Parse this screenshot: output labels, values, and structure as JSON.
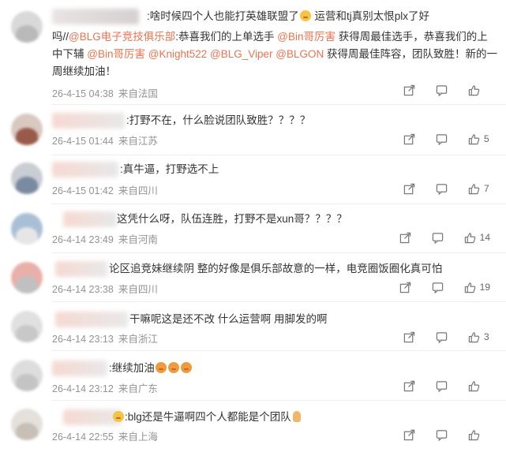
{
  "comments": [
    {
      "lines": [
        [
          {
            "t": ":啥时候四个人也能打英雄联盟了"
          },
          {
            "emoji": "crown-emoji"
          },
          {
            "t": " 运营和tj真别太恨plx了好"
          }
        ],
        [
          {
            "t": "吗//"
          },
          {
            "t": "@BLG电子竞技俱乐部",
            "link": true
          },
          {
            "t": ":恭喜我们的上单选手 "
          },
          {
            "t": "@Bin哥厉害",
            "link": true
          },
          {
            "t": " 获得周最佳选手，恭喜我们的上"
          }
        ],
        [
          {
            "t": "中下辅 "
          },
          {
            "t": "@Bin哥厉害",
            "link": true
          },
          {
            "t": " "
          },
          {
            "t": "@Knight522",
            "link": true
          },
          {
            "t": " "
          },
          {
            "t": "@BLG_Viper",
            "link": true
          },
          {
            "t": " "
          },
          {
            "t": "@BLGON",
            "link": true
          },
          {
            "t": " 获得周最佳阵容，团队致胜！新的一"
          }
        ],
        [
          {
            "t": "周继续加油！"
          }
        ]
      ],
      "date": "26-4-15 04:38",
      "location": "来自法国",
      "likes": ""
    },
    {
      "lines": [
        [
          {
            "t": ":打野不在，什么脸说团队致胜？？？？"
          }
        ]
      ],
      "date": "26-4-15 01:44",
      "location": "来自江苏",
      "likes": "5"
    },
    {
      "lines": [
        [
          {
            "t": ":真牛逼，打野选不上"
          }
        ]
      ],
      "date": "26-4-15 01:42",
      "location": "来自四川",
      "likes": "7"
    },
    {
      "lines": [
        [
          {
            "t": "这凭什么呀，队伍连胜，打野不是xun哥？？？？"
          }
        ]
      ],
      "date": "26-4-14 23:49",
      "location": "来自河南",
      "likes": "14"
    },
    {
      "lines": [
        [
          {
            "t": "论区追竞妹继续阴 整的好像是俱乐部故意的一样，电竞圈饭圈化真可怕"
          }
        ]
      ],
      "date": "26-4-14 23:38",
      "location": "来自四川",
      "likes": "19"
    },
    {
      "lines": [
        [
          {
            "t": "干嘛呢这是还不改 什么运营啊 用脚发的啊"
          }
        ]
      ],
      "date": "26-4-14 23:13",
      "location": "来自浙江",
      "likes": "3"
    },
    {
      "lines": [
        [
          {
            "t": ":继续加油"
          },
          {
            "emoji": "angry-emoji"
          },
          {
            "emoji": "angry-emoji"
          },
          {
            "emoji": "angry-emoji"
          }
        ]
      ],
      "date": "26-4-14 23:12",
      "location": "来自广东",
      "likes": ""
    },
    {
      "lines": [
        [
          {
            "emoji": "crown-emoji"
          },
          {
            "t": ":blg还是牛逼啊四个人都能是个团队"
          },
          {
            "emoji": "hand-emoji"
          }
        ]
      ],
      "date": "26-4-14 22:55",
      "location": "来自上海",
      "likes": ""
    }
  ],
  "colors": {
    "link": "#eb7350",
    "meta": "#939393",
    "divider": "#eeeeee"
  },
  "icons": {
    "share": "share-icon",
    "comment": "comment-icon",
    "like": "like-icon"
  }
}
